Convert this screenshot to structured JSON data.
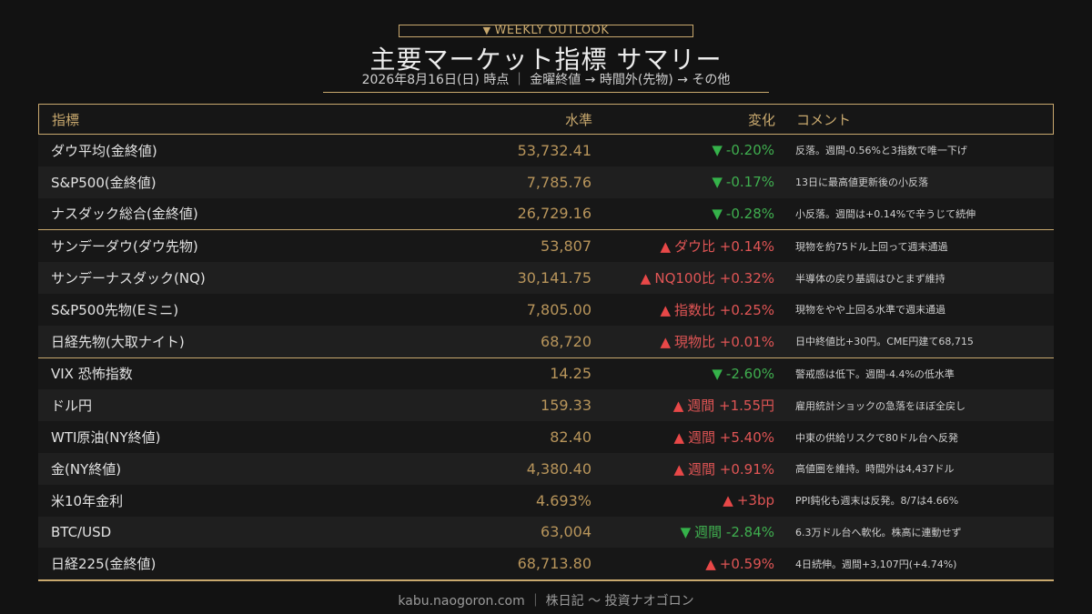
{
  "badge": {
    "icon": "triangle-down",
    "text": "WEEKLY OUTLOOK"
  },
  "title": "主要マーケット指標 サマリー",
  "subtitle": "2026年8月16日(日) 時点 ｜ 金曜終値 → 時間外(先物) → その他",
  "colors": {
    "accent": "#c9a96e",
    "up": "#e05555",
    "down": "#3fae4f",
    "level": "#b8955b"
  },
  "headers": {
    "name": "指標",
    "level": "水準",
    "change": "変化",
    "comment": "コメント"
  },
  "groups": [
    {
      "rows": [
        {
          "name": "ダウ平均(金終値)",
          "level": "53,732.41",
          "dir": "down",
          "arrow": "▼",
          "change": "-0.20%",
          "comment": "反落。週間-0.56%と3指数で唯一下げ"
        },
        {
          "name": "S&P500(金終値)",
          "level": "7,785.76",
          "dir": "down",
          "arrow": "▼",
          "change": "-0.17%",
          "comment": "13日に最高値更新後の小反落"
        },
        {
          "name": "ナスダック総合(金終値)",
          "level": "26,729.16",
          "dir": "down",
          "arrow": "▼",
          "change": "-0.28%",
          "comment": "小反落。週間は+0.14%で辛うじて続伸"
        }
      ]
    },
    {
      "rows": [
        {
          "name": "サンデーダウ(ダウ先物)",
          "level": "53,807",
          "dir": "up",
          "arrow": "▲",
          "change": "ダウ比 +0.14%",
          "comment": "現物を約75ドル上回って週末通過"
        },
        {
          "name": "サンデーナスダック(NQ)",
          "level": "30,141.75",
          "dir": "up",
          "arrow": "▲",
          "change": "NQ100比 +0.32%",
          "comment": "半導体の戻り基調はひとまず維持"
        },
        {
          "name": "S&P500先物(Eミニ)",
          "level": "7,805.00",
          "dir": "up",
          "arrow": "▲",
          "change": "指数比 +0.25%",
          "comment": "現物をやや上回る水準で週末通過"
        },
        {
          "name": "日経先物(大取ナイト)",
          "level": "68,720",
          "dir": "up",
          "arrow": "▲",
          "change": "現物比 +0.01%",
          "comment": "日中終値比+30円。CME円建て68,715"
        }
      ]
    },
    {
      "rows": [
        {
          "name": "VIX 恐怖指数",
          "level": "14.25",
          "dir": "down",
          "arrow": "▼",
          "change": "-2.60%",
          "comment": "警戒感は低下。週間-4.4%の低水準"
        },
        {
          "name": "ドル円",
          "level": "159.33",
          "dir": "up",
          "arrow": "▲",
          "change": "週間 +1.55円",
          "comment": "雇用統計ショックの急落をほぼ全戻し"
        },
        {
          "name": "WTI原油(NY終値)",
          "level": "82.40",
          "dir": "up",
          "arrow": "▲",
          "change": "週間 +5.40%",
          "comment": "中東の供給リスクで80ドル台へ反発"
        },
        {
          "name": "金(NY終値)",
          "level": "4,380.40",
          "dir": "up",
          "arrow": "▲",
          "change": "週間 +0.91%",
          "comment": "高値圏を維持。時間外は4,437ドル"
        },
        {
          "name": "米10年金利",
          "level": "4.693%",
          "dir": "up",
          "arrow": "▲",
          "change": "+3bp",
          "comment": "PPI鈍化も週末は反発。8/7は4.66%"
        },
        {
          "name": "BTC/USD",
          "level": "63,004",
          "dir": "down",
          "arrow": "▼",
          "change": "週間 -2.84%",
          "comment": "6.3万ドル台へ軟化。株高に連動せず"
        },
        {
          "name": "日経225(金終値)",
          "level": "68,713.80",
          "dir": "up",
          "arrow": "▲",
          "change": "+0.59%",
          "comment": "4日続伸。週間+3,107円(+4.74%)"
        }
      ]
    }
  ],
  "footer": "kabu.naogoron.com ｜ 株日記 〜 投資ナオゴロン"
}
